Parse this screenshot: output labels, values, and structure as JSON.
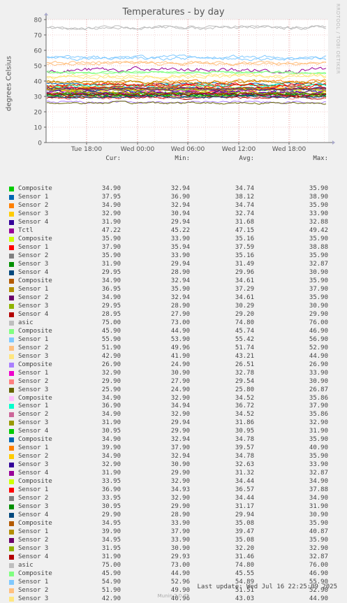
{
  "chart_data": {
    "type": "line",
    "title": "Temperatures - by day",
    "ylabel": "degrees Celsius",
    "ylim": [
      0,
      80
    ],
    "y_ticks": [
      0,
      10,
      20,
      30,
      40,
      50,
      60,
      70,
      80
    ],
    "x_ticks": [
      "Tue 18:00",
      "Wed 00:00",
      "Wed 06:00",
      "Wed 12:00",
      "Wed 18:00"
    ],
    "grid": true,
    "legend_headers": [
      "Cur:",
      "Min:",
      "Avg:",
      "Max:"
    ],
    "series": [
      {
        "name": "Composite",
        "color": "#00cc00",
        "cur": "34.90",
        "min": "32.94",
        "avg": "34.74",
        "max": "35.90"
      },
      {
        "name": "Sensor 1",
        "color": "#0066b3",
        "cur": "37.95",
        "min": "36.90",
        "avg": "38.12",
        "max": "38.90"
      },
      {
        "name": "Sensor 2",
        "color": "#ff8000",
        "cur": "34.90",
        "min": "32.94",
        "avg": "34.74",
        "max": "35.90"
      },
      {
        "name": "Sensor 3",
        "color": "#ffcc00",
        "cur": "32.90",
        "min": "30.94",
        "avg": "32.74",
        "max": "33.90"
      },
      {
        "name": "Sensor 4",
        "color": "#330099",
        "cur": "31.90",
        "min": "29.94",
        "avg": "31.68",
        "max": "32.88"
      },
      {
        "name": "Tctl",
        "color": "#990099",
        "cur": "47.22",
        "min": "45.22",
        "avg": "47.15",
        "max": "49.42"
      },
      {
        "name": "Composite",
        "color": "#ccff00",
        "cur": "35.90",
        "min": "33.90",
        "avg": "35.16",
        "max": "35.90"
      },
      {
        "name": "Sensor 1",
        "color": "#ff0000",
        "cur": "37.90",
        "min": "35.94",
        "avg": "37.59",
        "max": "38.88"
      },
      {
        "name": "Sensor 2",
        "color": "#808080",
        "cur": "35.90",
        "min": "33.90",
        "avg": "35.16",
        "max": "35.90"
      },
      {
        "name": "Sensor 3",
        "color": "#008f00",
        "cur": "31.90",
        "min": "29.94",
        "avg": "31.49",
        "max": "32.87"
      },
      {
        "name": "Sensor 4",
        "color": "#00487d",
        "cur": "29.95",
        "min": "28.90",
        "avg": "29.96",
        "max": "30.90"
      },
      {
        "name": "Composite",
        "color": "#b35a00",
        "cur": "34.90",
        "min": "32.94",
        "avg": "34.61",
        "max": "35.90"
      },
      {
        "name": "Sensor 1",
        "color": "#b38f00",
        "cur": "36.95",
        "min": "35.90",
        "avg": "37.29",
        "max": "37.90"
      },
      {
        "name": "Sensor 2",
        "color": "#6b006b",
        "cur": "34.90",
        "min": "32.94",
        "avg": "34.61",
        "max": "35.90"
      },
      {
        "name": "Sensor 3",
        "color": "#8fb300",
        "cur": "29.95",
        "min": "28.90",
        "avg": "30.29",
        "max": "30.90"
      },
      {
        "name": "Sensor 4",
        "color": "#b30000",
        "cur": "28.95",
        "min": "27.90",
        "avg": "29.20",
        "max": "29.90"
      },
      {
        "name": "asic",
        "color": "#bebebe",
        "cur": "75.00",
        "min": "73.00",
        "avg": "74.80",
        "max": "76.00"
      },
      {
        "name": "Composite",
        "color": "#80ff80",
        "cur": "45.90",
        "min": "44.90",
        "avg": "45.74",
        "max": "46.90"
      },
      {
        "name": "Sensor 1",
        "color": "#80c9ff",
        "cur": "55.90",
        "min": "53.90",
        "avg": "55.42",
        "max": "56.90"
      },
      {
        "name": "Sensor 2",
        "color": "#ffc080",
        "cur": "51.90",
        "min": "49.96",
        "avg": "51.74",
        "max": "52.90"
      },
      {
        "name": "Sensor 3",
        "color": "#ffe680",
        "cur": "42.90",
        "min": "41.90",
        "avg": "43.21",
        "max": "44.90"
      },
      {
        "name": "Composite",
        "color": "#aa80ff",
        "cur": "26.90",
        "min": "24.90",
        "avg": "26.51",
        "max": "26.90"
      },
      {
        "name": "Sensor 1",
        "color": "#ee00cc",
        "cur": "32.90",
        "min": "30.90",
        "avg": "32.78",
        "max": "33.90"
      },
      {
        "name": "Sensor 2",
        "color": "#ff8080",
        "cur": "29.90",
        "min": "27.90",
        "avg": "29.54",
        "max": "30.90"
      },
      {
        "name": "Sensor 3",
        "color": "#666600",
        "cur": "25.90",
        "min": "24.90",
        "avg": "25.80",
        "max": "26.87"
      },
      {
        "name": "Composite",
        "color": "#ffbfff",
        "cur": "34.90",
        "min": "32.90",
        "avg": "34.52",
        "max": "35.86"
      },
      {
        "name": "Sensor 1",
        "color": "#00ffcc",
        "cur": "36.90",
        "min": "34.94",
        "avg": "36.72",
        "max": "37.90"
      },
      {
        "name": "Sensor 2",
        "color": "#cc6699",
        "cur": "34.90",
        "min": "32.90",
        "avg": "34.52",
        "max": "35.86"
      },
      {
        "name": "Sensor 3",
        "color": "#999900",
        "cur": "31.90",
        "min": "29.94",
        "avg": "31.86",
        "max": "32.90"
      },
      {
        "name": "Sensor 4",
        "color": "#00cc00",
        "cur": "30.95",
        "min": "29.90",
        "avg": "30.95",
        "max": "31.90"
      },
      {
        "name": "Composite",
        "color": "#0066b3",
        "cur": "34.90",
        "min": "32.94",
        "avg": "34.78",
        "max": "35.90"
      },
      {
        "name": "Sensor 1",
        "color": "#ff8000",
        "cur": "39.90",
        "min": "37.90",
        "avg": "39.57",
        "max": "40.90"
      },
      {
        "name": "Sensor 2",
        "color": "#ffcc00",
        "cur": "34.90",
        "min": "32.94",
        "avg": "34.78",
        "max": "35.90"
      },
      {
        "name": "Sensor 3",
        "color": "#330099",
        "cur": "32.90",
        "min": "30.90",
        "avg": "32.63",
        "max": "33.90"
      },
      {
        "name": "Sensor 4",
        "color": "#990099",
        "cur": "31.90",
        "min": "29.90",
        "avg": "31.32",
        "max": "32.87"
      },
      {
        "name": "Composite",
        "color": "#ccff00",
        "cur": "33.95",
        "min": "32.90",
        "avg": "34.44",
        "max": "34.90"
      },
      {
        "name": "Sensor 1",
        "color": "#ff0000",
        "cur": "36.90",
        "min": "34.93",
        "avg": "36.57",
        "max": "37.88"
      },
      {
        "name": "Sensor 2",
        "color": "#808080",
        "cur": "33.95",
        "min": "32.90",
        "avg": "34.44",
        "max": "34.90"
      },
      {
        "name": "Sensor 3",
        "color": "#008f00",
        "cur": "30.95",
        "min": "29.90",
        "avg": "31.17",
        "max": "31.90"
      },
      {
        "name": "Sensor 4",
        "color": "#00487d",
        "cur": "29.90",
        "min": "28.90",
        "avg": "29.94",
        "max": "30.90"
      },
      {
        "name": "Composite",
        "color": "#b35a00",
        "cur": "34.95",
        "min": "33.90",
        "avg": "35.08",
        "max": "35.90"
      },
      {
        "name": "Sensor 1",
        "color": "#b38f00",
        "cur": "39.90",
        "min": "37.90",
        "avg": "39.47",
        "max": "40.87"
      },
      {
        "name": "Sensor 2",
        "color": "#6b006b",
        "cur": "34.95",
        "min": "33.90",
        "avg": "35.08",
        "max": "35.90"
      },
      {
        "name": "Sensor 3",
        "color": "#8fb300",
        "cur": "31.95",
        "min": "30.90",
        "avg": "32.20",
        "max": "32.90"
      },
      {
        "name": "Sensor 4",
        "color": "#b30000",
        "cur": "31.90",
        "min": "29.93",
        "avg": "31.46",
        "max": "32.87"
      },
      {
        "name": "asic",
        "color": "#bebebe",
        "cur": "75.00",
        "min": "73.00",
        "avg": "74.80",
        "max": "76.00"
      },
      {
        "name": "Composite",
        "color": "#80ff80",
        "cur": "45.90",
        "min": "44.90",
        "avg": "45.55",
        "max": "46.90"
      },
      {
        "name": "Sensor 1",
        "color": "#80c9ff",
        "cur": "54.90",
        "min": "52.96",
        "avg": "54.89",
        "max": "55.90"
      },
      {
        "name": "Sensor 2",
        "color": "#ffc080",
        "cur": "51.90",
        "min": "49.90",
        "avg": "51.51",
        "max": "52.90"
      },
      {
        "name": "Sensor 3",
        "color": "#ffe680",
        "cur": "42.90",
        "min": "40.96",
        "avg": "43.03",
        "max": "44.90"
      }
    ]
  },
  "watermark": "RRDTOOL / TOBI OETIKER",
  "last_update": "Last update: Wed Jul 16 22:25:09 2025",
  "footer": "Munin 2.0.75"
}
